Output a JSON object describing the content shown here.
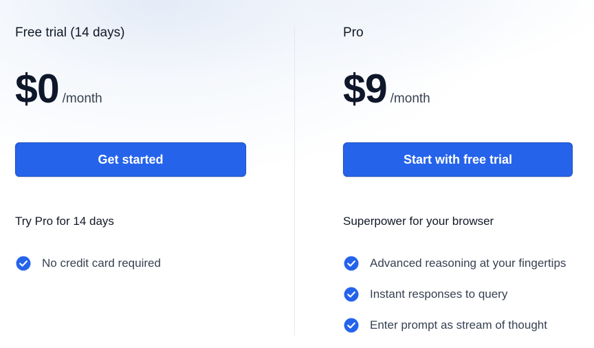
{
  "colors": {
    "accent": "#2563eb",
    "check": "#2563eb",
    "divider": "#e5e7eb"
  },
  "plans": [
    {
      "name": "Free trial (14 days)",
      "price": "$0",
      "period": "/month",
      "cta_label": "Get started",
      "tagline": "Try Pro for 14 days",
      "features": [
        "No credit card required"
      ]
    },
    {
      "name": "Pro",
      "price": "$9",
      "period": "/month",
      "cta_label": "Start with free trial",
      "tagline": "Superpower for your browser",
      "features": [
        "Advanced reasoning at your fingertips",
        "Instant responses to query",
        "Enter prompt as stream of thought"
      ]
    }
  ]
}
